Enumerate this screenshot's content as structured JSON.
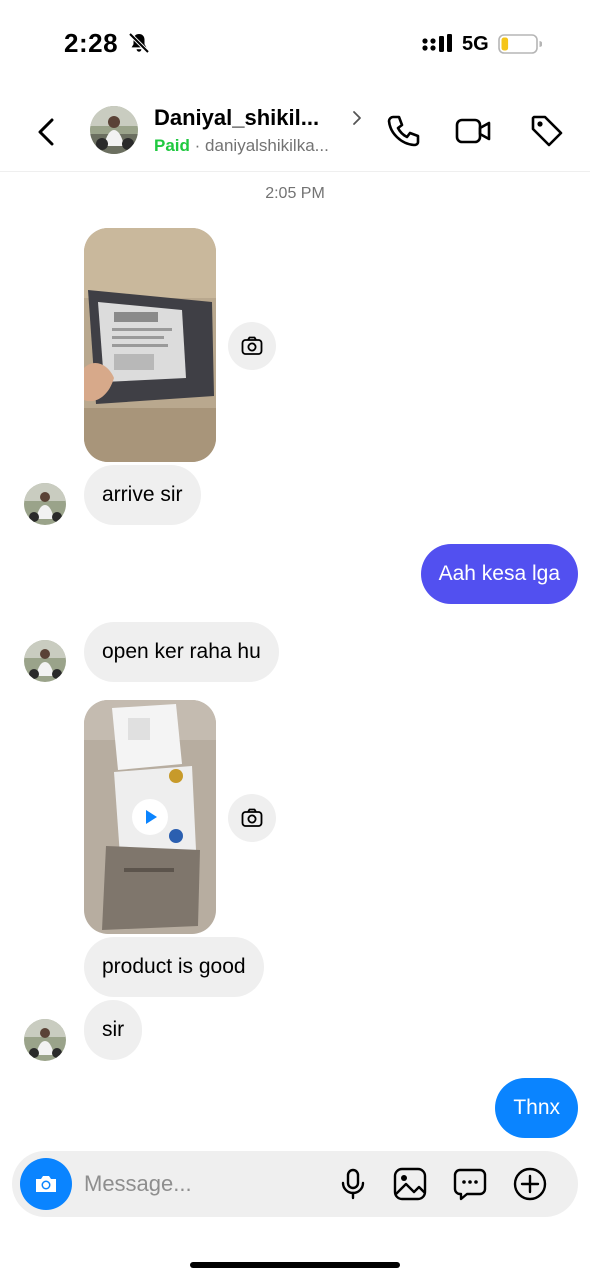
{
  "status_bar": {
    "time": "2:28",
    "network": "5G",
    "battery_level": 0.2,
    "battery_color": "#f5c518",
    "silent_mode": true
  },
  "header": {
    "contact_name": "Daniyal_shikil...",
    "badge": "Paid",
    "separator": "·",
    "username": "daniyalshikilka...",
    "icons": [
      "back-icon",
      "phone-icon",
      "video-icon",
      "tag-icon"
    ]
  },
  "chat": {
    "timestamp": "2:05 PM",
    "messages": [
      {
        "from": "contact",
        "type": "photo",
        "description_icon": "camera-icon"
      },
      {
        "from": "contact",
        "type": "text",
        "text": "arrive sir"
      },
      {
        "from": "me",
        "type": "text",
        "text": "Aah kesa lga"
      },
      {
        "from": "contact",
        "type": "text",
        "text": "open ker raha hu"
      },
      {
        "from": "contact",
        "type": "video",
        "description_icon": "camera-icon"
      },
      {
        "from": "contact",
        "type": "text",
        "text": "product is good"
      },
      {
        "from": "contact",
        "type": "text",
        "text": "sir"
      },
      {
        "from": "me",
        "type": "text",
        "text": "Thnx"
      }
    ]
  },
  "composer": {
    "placeholder": "Message...",
    "value": "",
    "icons": [
      "camera-icon",
      "mic-icon",
      "gallery-icon",
      "sticker-icon",
      "plus-icon"
    ]
  },
  "colors": {
    "accent_blue": "#0a84ff",
    "outgoing_purple": "#5250f0",
    "outgoing_blue": "#0a84ff",
    "incoming_bubble": "#efefef",
    "paid_green": "#20c940"
  }
}
